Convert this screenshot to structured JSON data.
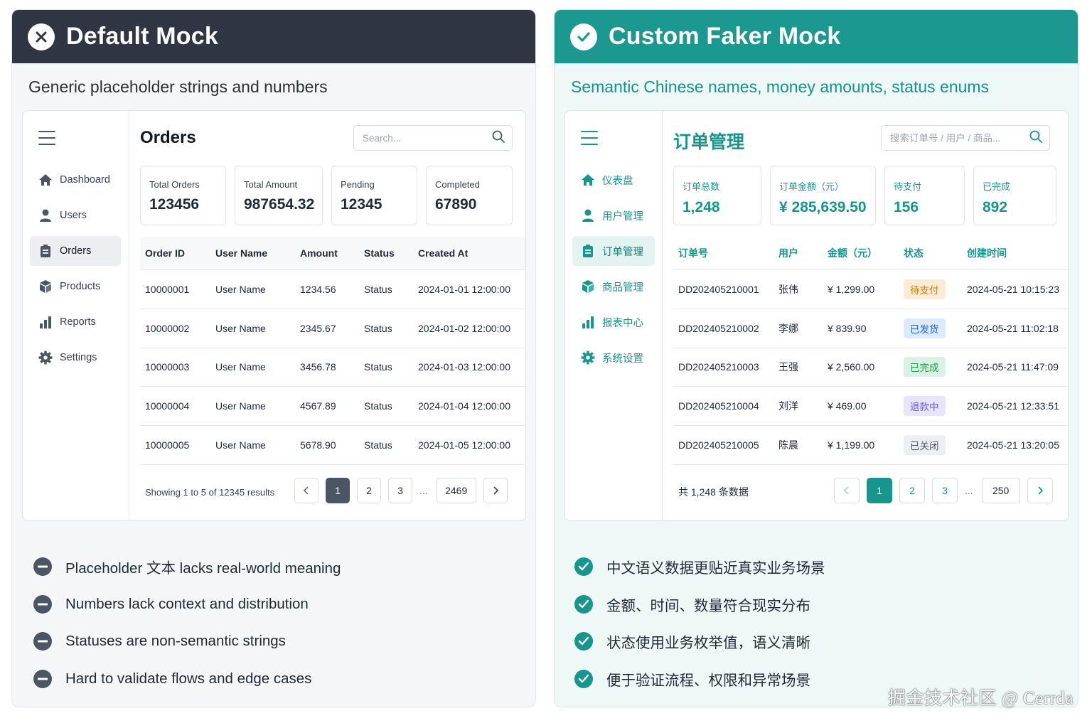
{
  "left": {
    "title": "Default Mock",
    "subtitle": "Generic placeholder strings and numbers",
    "nav": [
      {
        "label": "Dashboard",
        "icon": "home-icon"
      },
      {
        "label": "Users",
        "icon": "user-icon"
      },
      {
        "label": "Orders",
        "icon": "clipboard-icon",
        "active": true
      },
      {
        "label": "Products",
        "icon": "box-icon"
      },
      {
        "label": "Reports",
        "icon": "bar-chart-icon"
      },
      {
        "label": "Settings",
        "icon": "gear-icon"
      }
    ],
    "page_title": "Orders",
    "search_placeholder": "Search...",
    "stats": [
      {
        "label": "Total Orders",
        "value": "123456"
      },
      {
        "label": "Total Amount",
        "value": "987654.32"
      },
      {
        "label": "Pending",
        "value": "12345"
      },
      {
        "label": "Completed",
        "value": "67890"
      }
    ],
    "columns": [
      "Order ID",
      "User Name",
      "Amount",
      "Status",
      "Created At"
    ],
    "rows": [
      [
        "10000001",
        "User Name",
        "1234.56",
        "Status",
        "2024-01-01 12:00:00"
      ],
      [
        "10000002",
        "User Name",
        "2345.67",
        "Status",
        "2024-01-02 12:00:00"
      ],
      [
        "10000003",
        "User Name",
        "3456.78",
        "Status",
        "2024-01-03 12:00:00"
      ],
      [
        "10000004",
        "User Name",
        "4567.89",
        "Status",
        "2024-01-04 12:00:00"
      ],
      [
        "10000005",
        "User Name",
        "5678.90",
        "Status",
        "2024-01-05 12:00:00"
      ]
    ],
    "footer": "Showing 1 to 5 of 12345 results",
    "pages": [
      "1",
      "2",
      "3",
      "2469"
    ],
    "ellipsis": "...",
    "bullets": [
      "Placeholder 文本 lacks real-world meaning",
      "Numbers lack context and distribution",
      "Statuses are non-semantic strings",
      "Hard to validate flows and edge cases"
    ]
  },
  "right": {
    "title": "Custom Faker Mock",
    "subtitle": "Semantic Chinese names, money amounts, status enums",
    "nav": [
      {
        "label": "仪表盘",
        "icon": "home-icon"
      },
      {
        "label": "用户管理",
        "icon": "user-icon"
      },
      {
        "label": "订单管理",
        "icon": "clipboard-icon",
        "active": true
      },
      {
        "label": "商品管理",
        "icon": "box-icon"
      },
      {
        "label": "报表中心",
        "icon": "bar-chart-icon"
      },
      {
        "label": "系统设置",
        "icon": "gear-icon"
      }
    ],
    "page_title": "订单管理",
    "search_placeholder": "搜索订单号 / 用户 / 商品...",
    "stats": [
      {
        "label": "订单总数",
        "value": "1,248"
      },
      {
        "label": "订单金额（元）",
        "value": "¥ 285,639.50"
      },
      {
        "label": "待支付",
        "value": "156"
      },
      {
        "label": "已完成",
        "value": "892"
      }
    ],
    "columns": [
      "订单号",
      "用户",
      "金额（元）",
      "状态",
      "创建时间"
    ],
    "rows": [
      [
        "DD202405210001",
        "张伟",
        "¥ 1,299.00",
        "待支付",
        "2024-05-21 10:15:23"
      ],
      [
        "DD202405210002",
        "李娜",
        "¥ 839.90",
        "已发货",
        "2024-05-21 11:02:18"
      ],
      [
        "DD202405210003",
        "王强",
        "¥ 2,560.00",
        "已完成",
        "2024-05-21 11:47:09"
      ],
      [
        "DD202405210004",
        "刘洋",
        "¥ 469.00",
        "退款中",
        "2024-05-21 12:33:51"
      ],
      [
        "DD202405210005",
        "陈晨",
        "¥ 1,199.00",
        "已关闭",
        "2024-05-21 13:20:05"
      ]
    ],
    "status_colors": {
      "待支付": {
        "bg": "#fdecd5",
        "fg": "#d97706"
      },
      "已发货": {
        "bg": "#dcebfb",
        "fg": "#2563eb"
      },
      "已完成": {
        "bg": "#daf2e6",
        "fg": "#16a34a"
      },
      "退款中": {
        "bg": "#e7e4fb",
        "fg": "#6d5ce7"
      },
      "已关闭": {
        "bg": "#eceef1",
        "fg": "#4b5563"
      }
    },
    "footer": "共 1,248 条数据",
    "pages": [
      "1",
      "2",
      "3",
      "250"
    ],
    "ellipsis": "...",
    "bullets": [
      "中文语义数据更贴近真实业务场景",
      "金额、时间、数量符合现实分布",
      "状态使用业务枚举值，语义清晰",
      "便于验证流程、权限和异常场景"
    ]
  },
  "watermark": "掘金技术社区 @ Cerrda"
}
